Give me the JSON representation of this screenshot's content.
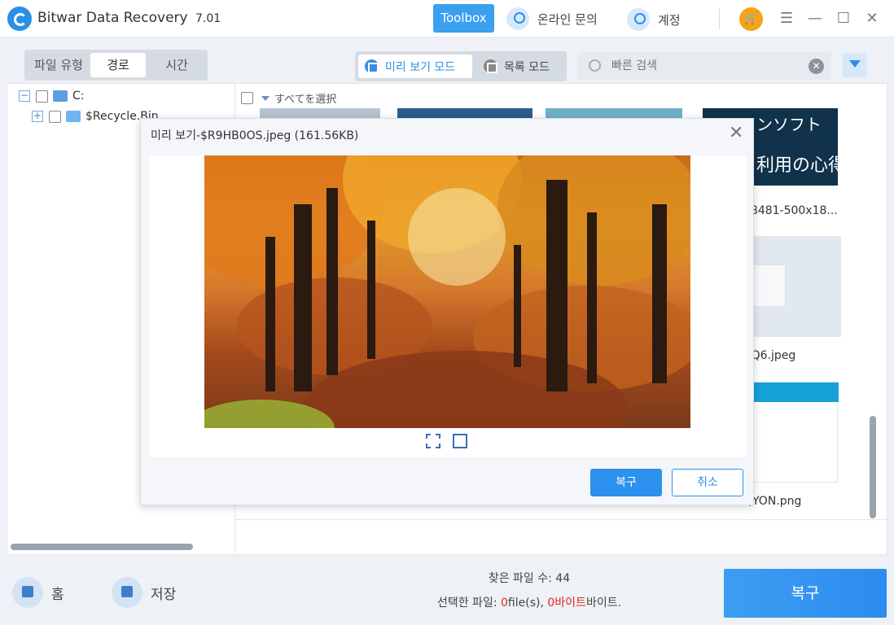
{
  "window": {
    "app_title": "Bitwar Data Recovery",
    "version": "7.01",
    "toolbox_label": "Toolbox",
    "support_label": "온라인 문의",
    "account_label": "계정"
  },
  "filter_tabs": [
    "파일 유형",
    "경로",
    "시간"
  ],
  "active_filter_tab": "경로",
  "view_modes": [
    "미리 보기 모드",
    "목록 모드"
  ],
  "active_view_mode": "미리 보기 모드",
  "search": {
    "placeholder": "빠른 검색"
  },
  "tree": {
    "drive_label": "C:",
    "folder_label": "$Recycle.Bin"
  },
  "grid": {
    "select_all_label": "すべてを選択",
    "visible_names": [
      "28481-500x18...",
      "VQ6.jpeg",
      "QYON.png"
    ],
    "thumb_text_1": "ンソフト",
    "thumb_text_2": "利用の心得"
  },
  "preview": {
    "title": "미리 보기-$R9HB0OS.jpeg (161.56KB)",
    "recover_label": "복구",
    "cancel_label": "취소"
  },
  "footer": {
    "home_label": "홈",
    "save_label": "저장",
    "found_label": "찾은 파일 수: 44",
    "selected_prefix": "선택한 파일: ",
    "selected_count": "0",
    "selected_files_unit": "file(s), ",
    "selected_bytes": "0바이트",
    "selected_suffix": "바이트.",
    "recover_label": "복구"
  },
  "colors": {
    "accent": "#2b90ee",
    "warning_red": "#e5261c",
    "cart_orange": "#f7a218"
  }
}
